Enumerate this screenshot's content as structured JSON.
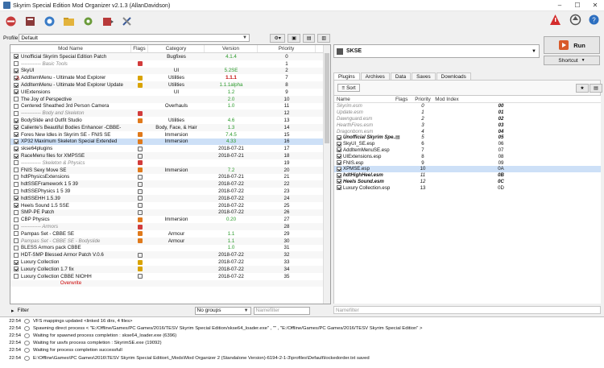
{
  "window": {
    "title": "Skyrim Special Edition Mod Organizer v2.1.3 (AllanDavidson)"
  },
  "profile": {
    "label": "Profile",
    "value": "Default"
  },
  "modlist": {
    "headers": [
      "Mod Name",
      "Flags",
      "Category",
      "Version",
      "Priority"
    ],
    "rows": [
      {
        "name": "Unofficial Skyrim Special Edition Patch",
        "checked": true,
        "cat": "Bugfixes",
        "ver": "4.1.4",
        "pri": "0"
      },
      {
        "name": "------------ Basic Tools",
        "sep": true,
        "flag": "red",
        "pri": "1"
      },
      {
        "name": "SkyUI",
        "checked": true,
        "cat": "UI",
        "ver": "5.2SE",
        "pri": "2"
      },
      {
        "name": "AddItemMenu - Ultimate Mod Explorer",
        "checked": true,
        "flag": "yellow",
        "cat": "Utilities",
        "ver": "1.1.1",
        "warn": true,
        "pri": "7"
      },
      {
        "name": "AddItemMenu - Ultimate Mod Explorer Update",
        "checked": true,
        "flag": "yellow",
        "cat": "Utilities",
        "ver": "1.1.1alpha",
        "pri": "8"
      },
      {
        "name": "UIExtensions",
        "checked": true,
        "cat": "UI",
        "ver": "1.2",
        "pri": "9"
      },
      {
        "name": "The Joy of Perspective",
        "checked": false,
        "cat": "",
        "ver": "2.0",
        "pri": "10"
      },
      {
        "name": "Centered Sheathed 3rd Person Camera",
        "checked": false,
        "cat": "Overhauls",
        "ver": "1.0",
        "pri": "11"
      },
      {
        "name": "------------ Body and Skeleton",
        "sep": true,
        "flag": "red",
        "pri": "12"
      },
      {
        "name": "BodySlide and Outfit Studio",
        "checked": true,
        "flag": "orange",
        "cat": "Utilities",
        "ver": "4.6",
        "pri": "13"
      },
      {
        "name": "Caliente's Beautiful Bodies Enhancer -CBBE-",
        "checked": true,
        "cat": "Body, Face, & Hair",
        "ver": "1.3",
        "pri": "14"
      },
      {
        "name": "Fores New Idles in Skyrim SE - FNIS SE",
        "checked": true,
        "flag": "orange",
        "cat": "Immersion",
        "ver": "7.4.5",
        "pri": "15"
      },
      {
        "name": "XP32 Maximum Skeleton Special Extended",
        "checked": true,
        "flag": "orange",
        "cat": "Immersion",
        "ver": "4.33",
        "pri": "16",
        "sel": true
      },
      {
        "name": "skse64plugins",
        "checked": true,
        "flag": "doc",
        "cat": "",
        "ver": "2018-07-21",
        "pri": "17"
      },
      {
        "name": "RaceMenu files for XMPSSE",
        "checked": true,
        "flag": "doc",
        "cat": "",
        "ver": "2018-07-21",
        "pri": "18"
      },
      {
        "name": "------------ Skeleton & Physics",
        "sep": true,
        "flag": "red",
        "pri": "19"
      },
      {
        "name": "FNIS Sexy Move SE",
        "checked": false,
        "flag": "orange",
        "cat": "Immersion",
        "ver": "7.2",
        "pri": "20"
      },
      {
        "name": "hdtPhysicsExtensions",
        "checked": false,
        "flag": "doc",
        "cat": "",
        "ver": "2018-07-21",
        "pri": "21"
      },
      {
        "name": "hdtSSEFramework 1 5 39",
        "checked": false,
        "flag": "doc",
        "cat": "",
        "ver": "2018-07-22",
        "pri": "22"
      },
      {
        "name": "hdtSSEPhysics 1 5 39",
        "checked": false,
        "flag": "doc",
        "cat": "",
        "ver": "2018-07-22",
        "pri": "23"
      },
      {
        "name": "hdtSSEHH 1.5.39",
        "checked": true,
        "flag": "doc",
        "cat": "",
        "ver": "2018-07-22",
        "pri": "24"
      },
      {
        "name": "Heels Sound 1.5 SSE",
        "checked": true,
        "flag": "doc",
        "cat": "",
        "ver": "2018-07-22",
        "pri": "25"
      },
      {
        "name": "SMP-PE Patch",
        "checked": false,
        "flag": "doc",
        "cat": "",
        "ver": "2018-07-22",
        "pri": "26"
      },
      {
        "name": "CBP Physics",
        "checked": false,
        "flag": "orange",
        "cat": "Immersion",
        "ver": "0.20",
        "pri": "27"
      },
      {
        "name": "------------ Armors",
        "sep": true,
        "flag": "red",
        "pri": "28"
      },
      {
        "name": "Pampas Set - CBBE SE",
        "checked": false,
        "flag": "orange",
        "cat": "Armour",
        "ver": "1.1",
        "pri": "29"
      },
      {
        "name": "Pampas Set - CBBE SE - Bodyslide",
        "sep": true,
        "flag": "orange",
        "cat": "Armour",
        "ver": "1.1",
        "pri": "30"
      },
      {
        "name": "BLESS Armors pack CBBE",
        "checked": false,
        "cat": "",
        "ver": "1.0",
        "pri": "31"
      },
      {
        "name": "HDT-SMP Blessed Armor Patch V.0.6",
        "checked": false,
        "flag": "doc",
        "cat": "",
        "ver": "2018-07-22",
        "pri": "32"
      },
      {
        "name": "Luxury Collection",
        "checked": true,
        "flag": "yellow",
        "cat": "",
        "ver": "2018-07-22",
        "pri": "33"
      },
      {
        "name": "Luxury Collection 1.7 fix",
        "checked": true,
        "flag": "yellow",
        "cat": "",
        "ver": "2018-07-22",
        "pri": "34"
      },
      {
        "name": "Luxury Collection CBBE NIOHH",
        "checked": false,
        "flag": "doc",
        "cat": "",
        "ver": "2018-07-22",
        "pri": "35"
      },
      {
        "name": "Overwrite",
        "overwrite": true,
        "pri": ""
      }
    ]
  },
  "filter": {
    "label": "Filter",
    "groups": "No groups",
    "placeholder": "Namefilter"
  },
  "executable": {
    "value": "SKSE",
    "run": "Run",
    "shortcut": "Shortcut"
  },
  "tabs": [
    "Plugins",
    "Archives",
    "Data",
    "Saves",
    "Downloads"
  ],
  "plugins": {
    "sort": "Sort",
    "headers": [
      "Name",
      "Flags",
      "Priority",
      "Mod Index"
    ],
    "rows": [
      {
        "name": "Skyrim.esm",
        "pri": "0",
        "idx": "00",
        "style": "italic-gray"
      },
      {
        "name": "Update.esm",
        "pri": "1",
        "idx": "01",
        "style": "italic-gray"
      },
      {
        "name": "Dawnguard.esm",
        "pri": "2",
        "idx": "02",
        "style": "italic-gray"
      },
      {
        "name": "HearthFires.esm",
        "pri": "3",
        "idx": "03",
        "style": "italic-gray"
      },
      {
        "name": "Dragonborn.esm",
        "pri": "4",
        "idx": "04",
        "style": "italic-gray"
      },
      {
        "name": "Unofficial Skyrim Spe...",
        "pri": "5",
        "idx": "05",
        "checked": true,
        "style": "bold"
      },
      {
        "name": "SkyUI_SE.esp",
        "pri": "6",
        "idx": "06",
        "checked": true
      },
      {
        "name": "AddItemMenuSE.esp",
        "pri": "7",
        "idx": "07",
        "checked": true
      },
      {
        "name": "UIExtensions.esp",
        "pri": "8",
        "idx": "08",
        "checked": true
      },
      {
        "name": "FNIS.esp",
        "pri": "9",
        "idx": "09",
        "checked": true
      },
      {
        "name": "XPMSE.esp",
        "pri": "10",
        "idx": "0A",
        "checked": true,
        "sel": true
      },
      {
        "name": "hdtHighHeel.esm",
        "pri": "11",
        "idx": "0B",
        "checked": true,
        "style": "bold"
      },
      {
        "name": "Heels Sound.esm",
        "pri": "12",
        "idx": "0C",
        "checked": true,
        "style": "bold"
      },
      {
        "name": "Luxury Collection.esp",
        "pri": "13",
        "idx": "0D",
        "checked": true
      }
    ],
    "filter_placeholder": "Namefilter"
  },
  "log": [
    {
      "t": "22:54",
      "m": "VFS mappings updated <linked 16 dirs, 4 files>"
    },
    {
      "t": "22:54",
      "m": "Spawning direct process < \"E:/Offline/Games/PC Games/2016/TESV Skyrim Special Edition/skse64_loader.exe\" , \"\" , \"E:/Offline/Games/PC Games/2016/TESV Skyrim Special Edition\" >"
    },
    {
      "t": "22:54",
      "m": "Waiting for spawned process completion : skse64_loader.exe (6396)"
    },
    {
      "t": "22:54",
      "m": "Waiting for usvfs process completion : SkyrimSE.exe (19092)"
    },
    {
      "t": "22:54",
      "m": "Waiting for process completion successfull"
    },
    {
      "t": "22:54",
      "m": "E:\\Offline\\Games\\PC Games\\2016\\TESV Skyrim Special Edition\\_Mods\\Mod Organizer 2 (Standalone Version)-6194-2-1-3\\profiles\\Default\\lockedorder.txt saved"
    }
  ],
  "colors": {
    "accent": "#cde0f7",
    "version_green": "#2a9a2a",
    "version_red": "#c00000",
    "flag_red": "#d23b3b",
    "flag_orange": "#e07a1c",
    "flag_yellow": "#d9a300"
  }
}
